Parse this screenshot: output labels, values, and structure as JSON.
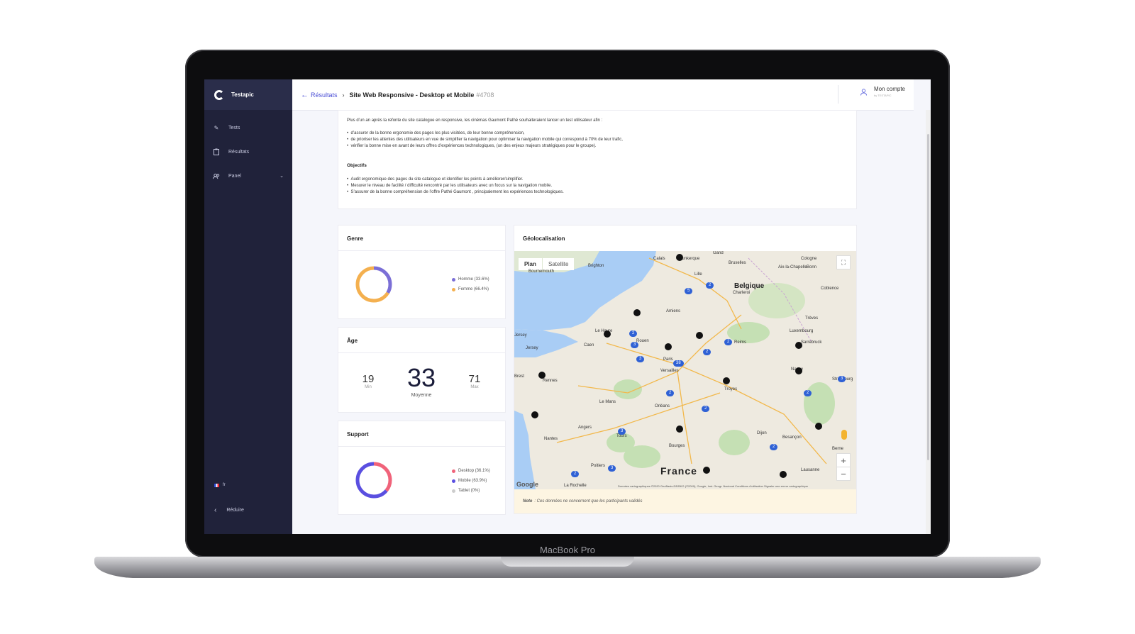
{
  "device": {
    "label": "MacBook Pro"
  },
  "sidebar": {
    "brand": "Testapic",
    "items": [
      {
        "label": "Tests",
        "icon": "pencil-icon"
      },
      {
        "label": "Résultats",
        "icon": "clipboard-icon"
      },
      {
        "label": "Panel",
        "icon": "users-icon"
      }
    ],
    "language": "fr",
    "reduce_label": "Réduire"
  },
  "header": {
    "back_label": "Résultats",
    "title": "Site Web Responsive - Desktop et Mobile",
    "test_id": "#4708",
    "account_label": "Mon compte",
    "account_sub": "by TESTAPIC"
  },
  "description": {
    "intro": "Plus d’un an après la refonte du site catalogue en responsive, les cinémas Gaumont Pathé souhaiteraient lancer un test utilisateur afin :",
    "bullets": [
      "d’assurer de la bonne ergonomie des pages les plus visitées, de leur bonne compréhension,",
      "de prioriser les attentes des utilisateurs en vue de simplifier la navigation pour optimiser la navigation mobile qui correspond à 70% de leur trafic,",
      "vérifier la bonne mise en avant de leurs offres d’expériences technologiques, (un des enjeux majeurs stratégiques pour le groupe)."
    ],
    "objectives_title": "Objectifs",
    "objectives": [
      "Audit ergonomique des pages du site catalogue et identifier les points à améliorer/simplifier.",
      "Mesurer le niveau de facilité / difficulté rencontré par les utilisateurs avec un focus sur la navigation mobile.",
      "S’assurer de la bonne compréhension de  l’offre Pathé Gaumont , principalement les expériences technologiques."
    ]
  },
  "genre": {
    "title": "Genre",
    "legend": [
      {
        "label": "Homme (33.6%)",
        "value": 33.6,
        "color": "#7b6fd6"
      },
      {
        "label": "Femme (66.4%)",
        "value": 66.4,
        "color": "#f4b04f"
      }
    ]
  },
  "age": {
    "title": "Âge",
    "min_value": "19",
    "min_label": "Min",
    "mean_value": "33",
    "mean_label": "Moyenne",
    "max_value": "71",
    "max_label": "Max"
  },
  "support": {
    "title": "Support",
    "legend": [
      {
        "label": "Desktop (36.1%)",
        "value": 36.1,
        "color": "#f0637a"
      },
      {
        "label": "Mobile (63.9%)",
        "value": 63.9,
        "color": "#5a4fe0"
      },
      {
        "label": "Tablet (0%)",
        "value": 0,
        "color": "#cccccc"
      }
    ]
  },
  "geo": {
    "title": "Géolocalisation",
    "tab_plan": "Plan",
    "tab_satellite": "Satellite",
    "note_label": "Note",
    "note_text": ": Ces données ne concernent que les participants validés",
    "google": "Google",
    "footer": "Données cartographiques ©2020 GeoBasis-DE/BKG (©2009), Google, Inst. Geogr. Nacional   Conditions d’utilisation   Signaler une erreur cartographique",
    "countries": {
      "france": "France",
      "belgique": "Belgique"
    },
    "cities": [
      "Calais",
      "Dunkerque",
      "Gand",
      "Bruxelles",
      "Cologne",
      "Bonn",
      "Aix-la-Chapelle",
      "Lille",
      "Coblence",
      "Charleroi",
      "Amiens",
      "Brighton",
      "Bournemouth",
      "Le Havre",
      "Caen",
      "Jersey",
      "Rouen",
      "Reims",
      "Trèves",
      "Luxembourg",
      "Sarrebruck",
      "Rennes",
      "Paris",
      "Versailles",
      "Troyes",
      "Strasbourg",
      "Le Mans",
      "Orléans",
      "Nancy",
      "Angers",
      "Tours",
      "Nantes",
      "Dijon",
      "Besançon",
      "Bourges",
      "Poitiers",
      "La Rochelle",
      "Lausanne",
      "Berne",
      "Brest",
      "Jersey"
    ],
    "clusters": [
      "2",
      "5",
      "2",
      "2",
      "3",
      "38",
      "2",
      "2",
      "2",
      "2",
      "3",
      "3",
      "3",
      "2",
      "2",
      "3"
    ]
  }
}
